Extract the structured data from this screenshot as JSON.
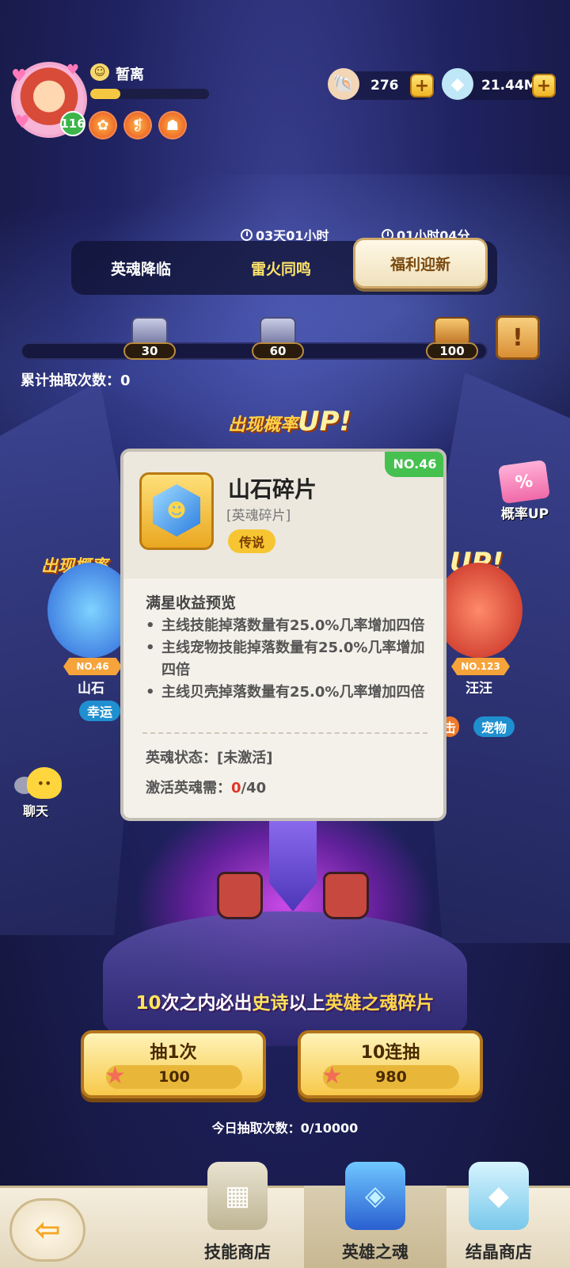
{
  "player": {
    "status": "暂离",
    "level": "116",
    "xp_fraction": 0.25,
    "buffs": [
      "buff-icon-1",
      "buff-icon-2",
      "buff-icon-3"
    ]
  },
  "currency": {
    "shells": "276",
    "crystals": "21.44M",
    "plus": "+"
  },
  "timers": {
    "event1": "03天01小时",
    "event2": "01小时04分"
  },
  "tabs": [
    {
      "label": "英魂降临"
    },
    {
      "label": "雷火同鸣"
    },
    {
      "label": "福利迎新"
    }
  ],
  "milestones": {
    "chests": [
      "30",
      "60",
      "100"
    ],
    "draw_count_label": "累计抽取次数：",
    "draw_count_value": "0",
    "progress": 0
  },
  "banner": {
    "up_text_prefix": "出现概率",
    "up_text_big": "UP!",
    "rate_up_label": "概率UP",
    "rate_up_cart": "%"
  },
  "side_cards": {
    "left": {
      "no": "NO.46",
      "name": "山石",
      "tag": "幸运"
    },
    "right": {
      "no": "NO.123",
      "name": "汪汪",
      "tag_partial": "击",
      "tag": "宠物"
    }
  },
  "chat": {
    "label": "聊天"
  },
  "popup": {
    "no": "NO.46",
    "title": "山石碎片",
    "subtitle": "[英魂碎片]",
    "rarity": "传说",
    "section_title": "满星收益预览",
    "bullets": [
      "主线技能掉落数量有25.0%几率增加四倍",
      "主线宠物技能掉落数量有25.0%几率增加四倍",
      "主线贝壳掉落数量有25.0%几率增加四倍"
    ],
    "state_label": "英魂状态：",
    "state_value": "[未激活]",
    "activate_label": "激活英魂需：",
    "activate_have": "0",
    "activate_need": "/40"
  },
  "guarantee": {
    "num": "10",
    "t1": "次之内必出",
    "t2": "史诗",
    "t3": "以上",
    "t4": "英雄之魂碎片"
  },
  "draw_buttons": [
    {
      "label": "抽1次",
      "cost": "100"
    },
    {
      "label": "10连抽",
      "cost": "980"
    }
  ],
  "today": {
    "text": "今日抽取次数：0/10000"
  },
  "bottom_nav": [
    {
      "label": "技能商店",
      "icon": "skill-shop-icon"
    },
    {
      "label": "英雄之魂",
      "icon": "hero-soul-icon"
    },
    {
      "label": "结晶商店",
      "icon": "crystal-shop-icon"
    }
  ],
  "colors": {
    "accent_gold": "#f7c94a",
    "rarity_gold": "#f6c531",
    "no_badge_green": "#46c04f",
    "red_count": "#e0352b"
  }
}
